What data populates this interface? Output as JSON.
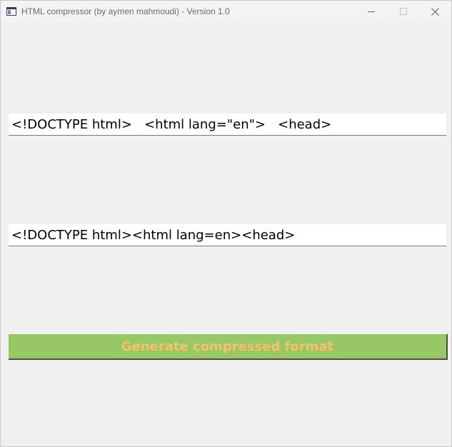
{
  "window": {
    "title": "HTML compressor (by aymen mahmoudi) - Version 1.0",
    "app_icon": "app-window-icon",
    "controls": {
      "minimize_icon": "minimize-icon",
      "maximize_icon": "maximize-icon",
      "close_icon": "close-icon"
    }
  },
  "input": {
    "value": "<!DOCTYPE html>   <html lang=\"en\">   <head>"
  },
  "output": {
    "value": "<!DOCTYPE html><html lang=en><head>"
  },
  "generate_button": {
    "label": "Generate compressed format",
    "background_color": "#98c865",
    "text_color": "#f4c26a"
  }
}
